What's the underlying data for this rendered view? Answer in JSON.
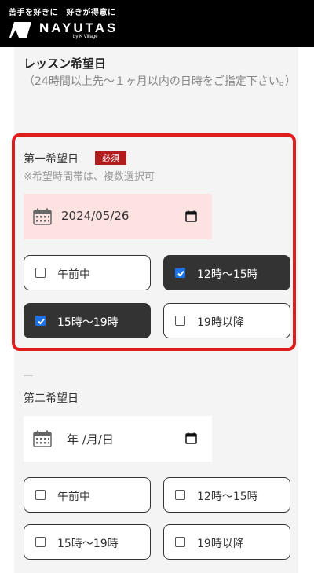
{
  "header": {
    "tagline": "苦手を好きに　好きが得意に",
    "brand": "NAYUTAS",
    "brand_sub": "by K Village"
  },
  "lesson": {
    "title": "レッスン希望日",
    "note": "（24時間以上先〜１ヶ月以内の日時をご指定下さい。）"
  },
  "first": {
    "title": "第一希望日",
    "required": "必須",
    "note": "※希望時間帯は、複数選択可",
    "date_value": "2024/05/26",
    "options": [
      {
        "label": "午前中",
        "checked": false
      },
      {
        "label": "12時〜15時",
        "checked": true
      },
      {
        "label": "15時〜19時",
        "checked": true
      },
      {
        "label": "19時以降",
        "checked": false
      }
    ]
  },
  "second": {
    "title": "第二希望日",
    "date_value": "年 /月/日",
    "options": [
      {
        "label": "午前中",
        "checked": false
      },
      {
        "label": "12時〜15時",
        "checked": false
      },
      {
        "label": "15時〜19時",
        "checked": false
      },
      {
        "label": "19時以降",
        "checked": false
      }
    ]
  },
  "colors": {
    "highlight": "#e01d1d",
    "required_badge": "#b11d1d",
    "checked_option": "#333333",
    "filled_date": "#fde2e2"
  }
}
